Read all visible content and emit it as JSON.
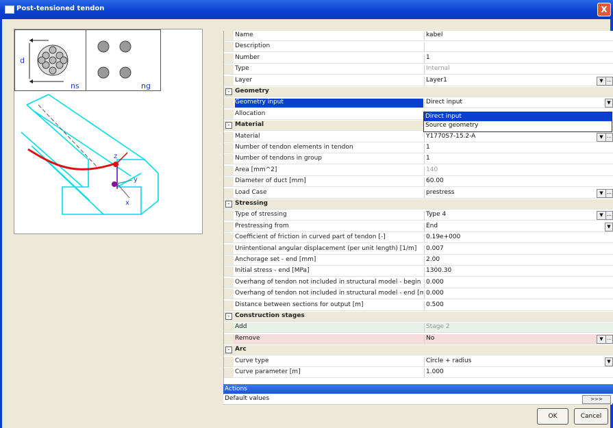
{
  "window": {
    "title": "Post-tensioned tendon",
    "close_label": "X"
  },
  "diagram": {
    "label_d": "d",
    "label_ns": "ns",
    "label_ng": "ng",
    "label_z": "z",
    "label_y": "y",
    "label_x": "x"
  },
  "properties": [
    {
      "type": "row",
      "name": "Name",
      "value": "kabel"
    },
    {
      "type": "row",
      "name": "Description",
      "value": ""
    },
    {
      "type": "row",
      "name": "Number",
      "value": "1"
    },
    {
      "type": "row",
      "name": "Type",
      "value": "Internal",
      "grey": true
    },
    {
      "type": "row",
      "name": "Layer",
      "value": "Layer1",
      "control": "dd-dots"
    },
    {
      "type": "cat",
      "name": "Geometry",
      "toggle": "-"
    },
    {
      "type": "row",
      "name": "Geometry input",
      "value": "Direct input",
      "control": "dd",
      "selected": true
    },
    {
      "type": "row",
      "name": "Allocation",
      "value": ""
    },
    {
      "type": "cat",
      "name": "Material",
      "toggle": "-"
    },
    {
      "type": "row",
      "name": "Material",
      "value": "Y1770S7-15.2-A",
      "control": "dd-dots"
    },
    {
      "type": "row",
      "name": "Number of tendon elements in tendon",
      "value": "1"
    },
    {
      "type": "row",
      "name": "Number of tendons in group",
      "value": "1"
    },
    {
      "type": "row",
      "name": "Area [mm^2]",
      "value": "140",
      "grey": true
    },
    {
      "type": "row",
      "name": "Diameter of duct [mm]",
      "value": "60.00"
    },
    {
      "type": "row",
      "name": "Load Case",
      "value": "prestress",
      "control": "dd-dots"
    },
    {
      "type": "cat",
      "name": "Stressing",
      "toggle": "-"
    },
    {
      "type": "row",
      "name": "Type of stressing",
      "value": "Type 4",
      "control": "dd-dots"
    },
    {
      "type": "row",
      "name": "Prestressing from",
      "value": "End",
      "control": "dd"
    },
    {
      "type": "row",
      "name": "Coefficient of friction in curved part of tendon [-]",
      "value": "0.19e+000"
    },
    {
      "type": "row",
      "name": "Unintentional angular displacement (per unit length) [1/m]",
      "value": "0.007"
    },
    {
      "type": "row",
      "name": "Anchorage set - end [mm]",
      "value": "2.00"
    },
    {
      "type": "row",
      "name": "Initial stress - end [MPa]",
      "value": "1300.30"
    },
    {
      "type": "row",
      "name": "Overhang of tendon not included in structural model - begin ...",
      "value": "0.000"
    },
    {
      "type": "row",
      "name": "Overhang of tendon not included in structural model - end [m]",
      "value": "0.000"
    },
    {
      "type": "row",
      "name": "Distance between sections for output [m]",
      "value": "0.500"
    },
    {
      "type": "cat",
      "name": "Construction stages",
      "toggle": "-"
    },
    {
      "type": "row",
      "name": "Add",
      "value": "Stage 2",
      "grey": true,
      "tint": "green"
    },
    {
      "type": "row",
      "name": "Remove",
      "value": "No",
      "control": "dd-dots",
      "tint": "pink"
    },
    {
      "type": "cat",
      "name": "Arc",
      "toggle": "-"
    },
    {
      "type": "row",
      "name": "Curve type",
      "value": "Circle + radius",
      "control": "dd"
    },
    {
      "type": "row",
      "name": "Curve parameter [m]",
      "value": "1.000"
    }
  ],
  "dropdown": {
    "options": [
      "Direct input",
      "Source geometry"
    ],
    "selected_index": 0
  },
  "actions": {
    "header": "Actions",
    "default_values": "Default values",
    "go_label": ">>>"
  },
  "buttons": {
    "ok": "OK",
    "cancel": "Cancel"
  },
  "colors": {
    "title_bar": "#0a3fd0",
    "selection": "#0a3fd0",
    "diagram_cyan": "#00e5f0",
    "tendon_red": "#e01010"
  }
}
